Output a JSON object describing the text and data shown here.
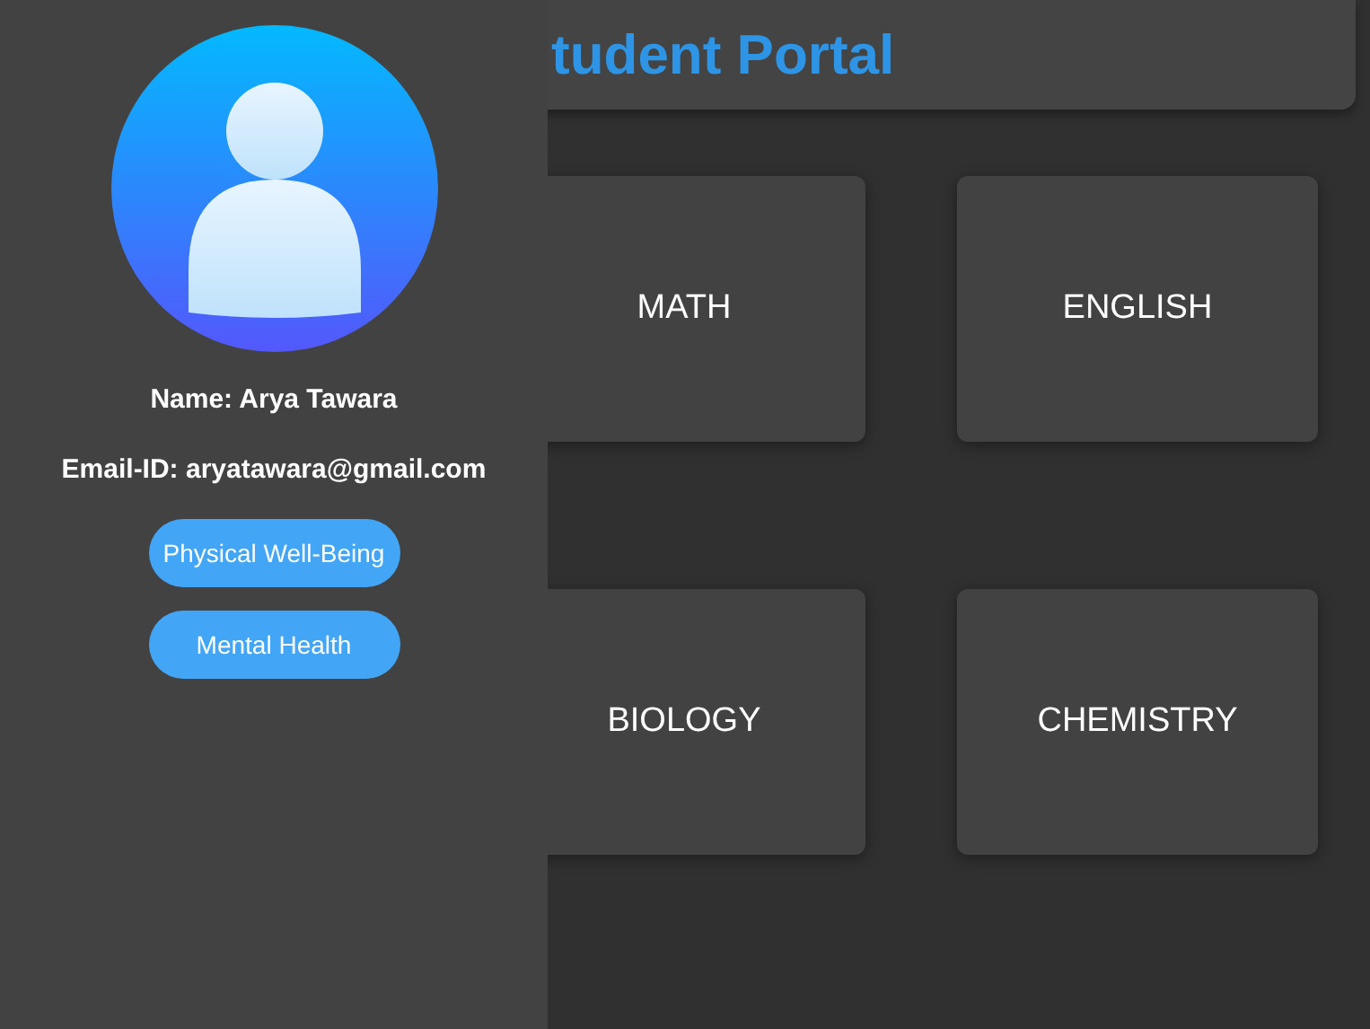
{
  "header": {
    "title": "tudent Portal"
  },
  "subjects": [
    {
      "label": "MATH"
    },
    {
      "label": "ENGLISH"
    },
    {
      "label": "BIOLOGY"
    },
    {
      "label": "CHEMISTRY"
    }
  ],
  "drawer": {
    "name": "Name: Arya Tawara",
    "email": "Email-ID: aryatawara@gmail.com",
    "buttons": [
      {
        "label": "Physical Well-Being"
      },
      {
        "label": "Mental Health"
      }
    ]
  }
}
